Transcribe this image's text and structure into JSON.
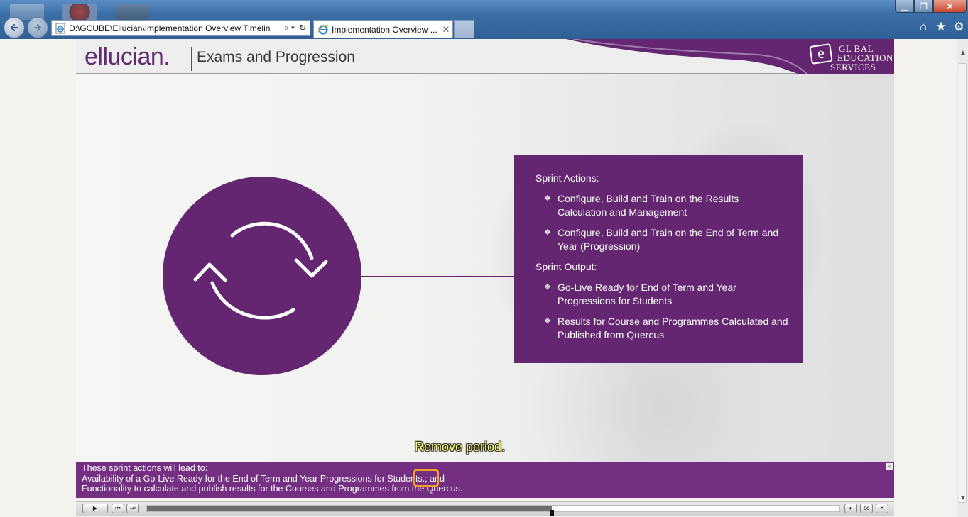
{
  "browser": {
    "address": "D:\\GCUBE\\Ellucian\\Implementation Overview Timelin",
    "address_search_glyph": "⌕ ▾",
    "address_refresh_glyph": "↻",
    "tab_title": "Implementation Overview ...",
    "tab_close": "✕",
    "window_min": "▁",
    "window_max": "❐",
    "window_close": "✕",
    "home_glyph": "⌂",
    "favorites_glyph": "★",
    "tools_glyph": "⚙"
  },
  "slide": {
    "logo": "ellucian.",
    "title": "Exams and Progression",
    "partner_logo": {
      "mark": "e",
      "line1": "GL   BAL",
      "line2": "EDUCATION",
      "line3": "SERVICES"
    },
    "colors": {
      "purple": "#642670",
      "caption_bar": "#742f83",
      "callout": "#ffff66",
      "highlight": "#f0a020"
    },
    "icon": "refresh-cycle-icon",
    "sprint_actions_heading": "Sprint Actions:",
    "sprint_actions": [
      "Configure, Build and Train on the Results Calculation and Management",
      "Configure, Build and Train on the End of Term and Year (Progression)"
    ],
    "sprint_output_heading": "Sprint Output:",
    "sprint_output": [
      "Go-Live Ready for End of Term and Year Progressions for Students",
      "Results for Course and Programmes Calculated and Published from Quercus"
    ],
    "bullet_glyph": "❖",
    "review_callout": "Remove period.",
    "captions": [
      "These sprint actions will lead to:",
      "Availability of a Go-Live Ready for the End of Term and Year Progressions for Students.; and",
      "Functionality to calculate and publish results for the Courses and Programmes from the Quercus."
    ],
    "captions_close": "✕"
  },
  "playbar": {
    "progress": 0.585,
    "play": "▶",
    "prev": "⏮",
    "next": "⏭",
    "volume": "◐",
    "cc": "cc",
    "close": "✕"
  }
}
